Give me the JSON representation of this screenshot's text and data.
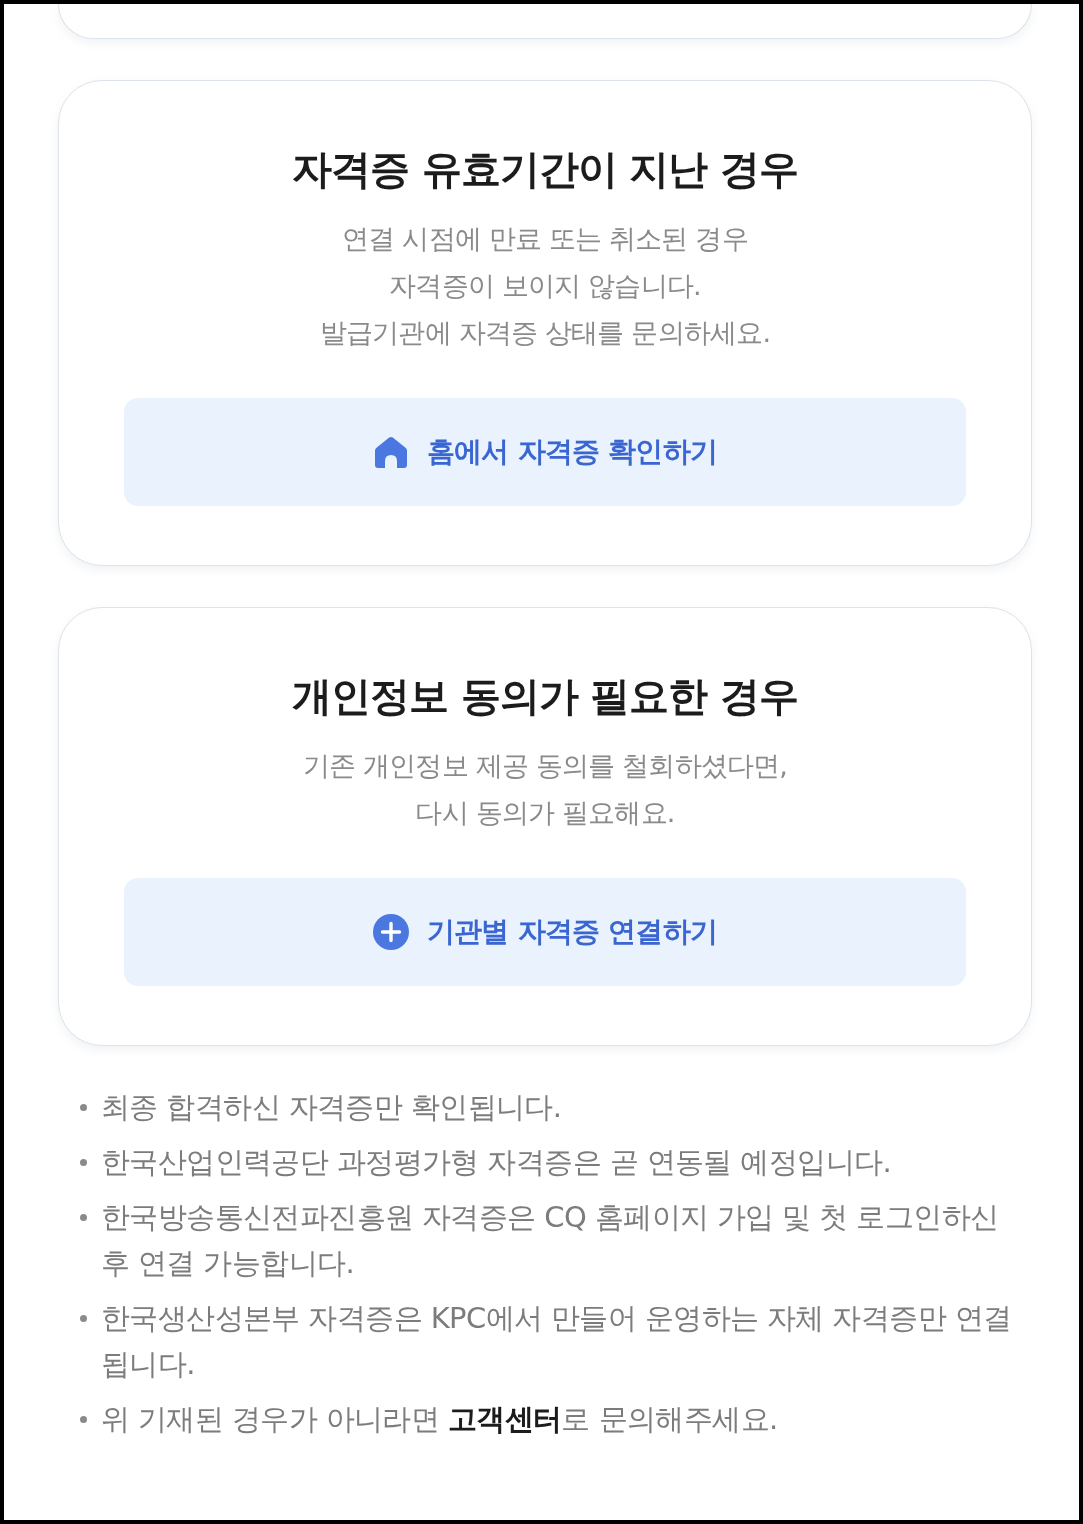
{
  "cards": [
    {
      "title": "자격증 유효기간이 지난 경우",
      "description": "연결 시점에 만료 또는 취소된 경우\n자격증이 보이지 않습니다.\n발급기관에 자격증 상태를 문의하세요.",
      "button": "홈에서 자격증 확인하기"
    },
    {
      "title": "개인정보 동의가 필요한 경우",
      "description": "기존 개인정보 제공 동의를 철회하셨다면,\n다시 동의가 필요해요.",
      "button": "기관별 자격증 연결하기"
    }
  ],
  "notes": [
    "최종 합격하신 자격증만 확인됩니다.",
    "한국산업인력공단 과정평가형 자격증은 곧 연동될 예정입니다.",
    "한국방송통신전파진흥원 자격증은 CQ 홈페이지 가입 및 첫 로그인하신 후 연결 가능합니다.",
    "한국생산성본부 자격증은 KPC에서 만들어 운영하는 자체 자격증만 연결됩니다.",
    "위 기재된 경우가 아니라면 **고객센터**로 문의해주세요."
  ]
}
